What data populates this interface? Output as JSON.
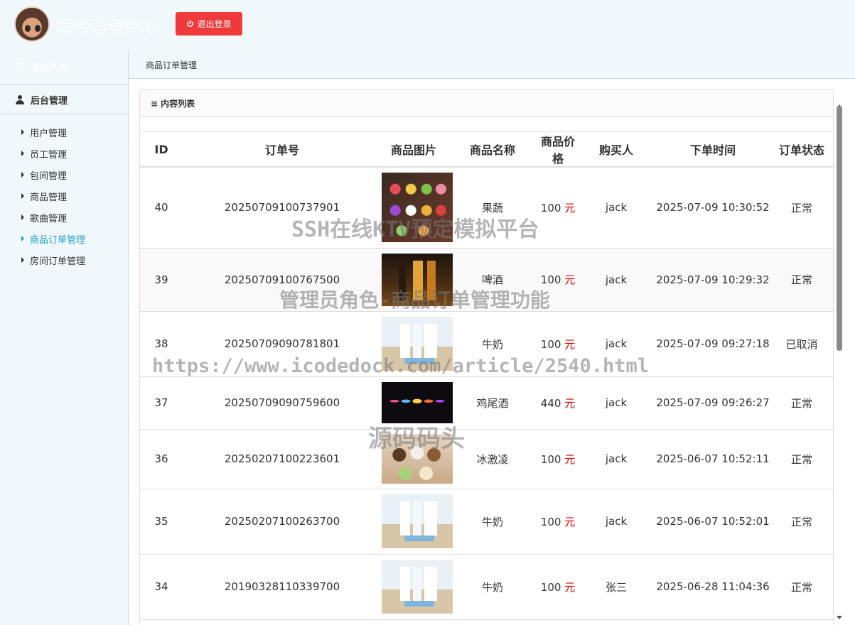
{
  "header": {
    "title": "后台管理中心",
    "logout_label": "退出登录"
  },
  "sidebar": {
    "menu_list_label": "菜单列表",
    "group_label": "后台管理",
    "items": [
      {
        "label": "用户管理"
      },
      {
        "label": "员工管理"
      },
      {
        "label": "包间管理"
      },
      {
        "label": "商品管理"
      },
      {
        "label": "歌曲管理"
      },
      {
        "label": "商品订单管理",
        "active": true
      },
      {
        "label": "房间订单管理"
      }
    ]
  },
  "breadcrumb": "商品订单管理",
  "panel": {
    "title": "内容列表"
  },
  "table": {
    "columns": [
      "ID",
      "订单号",
      "商品图片",
      "商品名称",
      "商品价格",
      "购买人",
      "下单时间",
      "订单状态"
    ],
    "currency_unit": "元",
    "rows": [
      {
        "id": "40",
        "order_no": "20250709100737901",
        "image": "fruits-image",
        "name": "果蔬",
        "price": "100",
        "buyer": "jack",
        "time": "2025-07-09 10:30:52",
        "status": "正常"
      },
      {
        "id": "39",
        "order_no": "20250709100767500",
        "image": "beer-image",
        "name": "啤酒",
        "price": "100",
        "buyer": "jack",
        "time": "2025-07-09 10:29:32",
        "status": "正常"
      },
      {
        "id": "38",
        "order_no": "20250709090781801",
        "image": "milk-image",
        "name": "牛奶",
        "price": "100",
        "buyer": "jack",
        "time": "2025-07-09 09:27:18",
        "status": "已取消"
      },
      {
        "id": "37",
        "order_no": "20250709090759600",
        "image": "cocktail-image",
        "name": "鸡尾酒",
        "price": "440",
        "buyer": "jack",
        "time": "2025-07-09 09:26:27",
        "status": "正常"
      },
      {
        "id": "36",
        "order_no": "20250207100223601",
        "image": "icecream-image",
        "name": "冰激凌",
        "price": "100",
        "buyer": "jack",
        "time": "2025-06-07 10:52:11",
        "status": "正常"
      },
      {
        "id": "35",
        "order_no": "20250207100263700",
        "image": "milk-image",
        "name": "牛奶",
        "price": "100",
        "buyer": "jack",
        "time": "2025-06-07 10:52:01",
        "status": "正常"
      },
      {
        "id": "34",
        "order_no": "20190328110339700",
        "image": "milk-image",
        "name": "牛奶",
        "price": "100",
        "buyer": "张三",
        "time": "2025-06-28 11:04:36",
        "status": "正常"
      }
    ]
  },
  "watermarks": {
    "line1": "SSH在线KTV预定模拟平台",
    "line2": "管理员角色-商品订单管理功能",
    "line3": "https://www.icodedock.com/article/2540.html",
    "line4": "源码码头"
  },
  "colors": {
    "accent": "#1e9fc4",
    "danger": "#ee3a3a",
    "price_unit": "#d60000",
    "header_bg": "#f1f8fc"
  }
}
